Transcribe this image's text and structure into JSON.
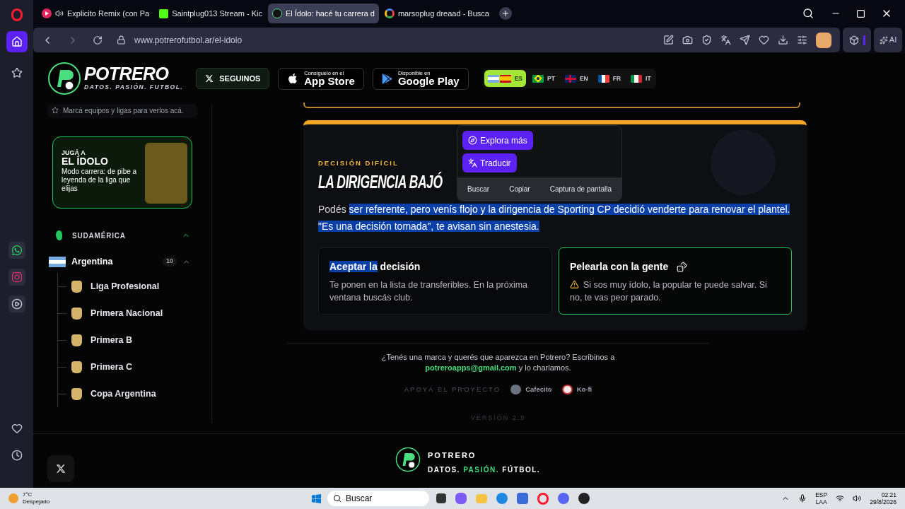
{
  "browser": {
    "tabs": [
      {
        "title": "Explicito Remix (con Pa",
        "kind": "video",
        "selected": false
      },
      {
        "title": "Saintplug013 Stream - Kic",
        "kind": "stream",
        "selected": false
      },
      {
        "title": "El Ídolo: hacé tu carrera d",
        "kind": "site",
        "selected": true
      },
      {
        "title": "marsoplug dreaad - Busca",
        "kind": "search",
        "selected": false
      }
    ],
    "url": "www.potrerofutbol.ar/el-idolo",
    "sidebar": [
      {
        "kind": "home",
        "selected": true
      },
      {
        "kind": "star",
        "selected": false
      },
      {
        "kind": "whatsapp",
        "selected": false
      },
      {
        "kind": "instagram",
        "selected": false
      },
      {
        "kind": "player",
        "selected": false
      },
      {
        "kind": "heart",
        "selected": false
      },
      {
        "kind": "clock",
        "selected": false
      }
    ],
    "ai_label": "AI"
  },
  "site_header": {
    "brand": "POTRERO",
    "tagline": "DATOS. PASIÓN. FUTBOL.",
    "follow": "SEGUINOS",
    "app_store": {
      "small": "Consiguelo en el",
      "big": "App Store"
    },
    "google_play": {
      "small": "Disponible en",
      "big": "Google Play"
    },
    "languages": [
      {
        "code": "ES",
        "selected": true
      },
      {
        "code": "PT",
        "selected": false
      },
      {
        "code": "EN",
        "selected": false
      },
      {
        "code": "FR",
        "selected": false
      },
      {
        "code": "IT",
        "selected": false
      }
    ]
  },
  "sidebar": {
    "hint": "Marcá equipos y ligas para verlos acá.",
    "promo": {
      "kicker": "JUGÁ A",
      "title": "EL ÍDOLO",
      "text": "Modo carrera: de pibe a leyenda de la liga que elijas"
    },
    "region": {
      "name": "SUDAMÉRICA",
      "expanded": true
    },
    "country": {
      "name": "Argentina",
      "count": "10",
      "expanded": true,
      "children": [
        {
          "name": "Liga Profesional"
        },
        {
          "name": "Primera Nacional"
        },
        {
          "name": "Primera B"
        },
        {
          "name": "Primera C"
        },
        {
          "name": "Copa Argentina"
        }
      ]
    }
  },
  "card": {
    "kicker": "DECISIÓN DIFÍCIL",
    "title": "LA DIRIGENCIA BAJÓ",
    "paragraph": [
      {
        "text": "Podés ",
        "selected": false
      },
      {
        "text": "ser referente, pero venís flojo y la dirigencia de Sporting CP decidió venderte para renovar el plantel. \"Es una decisión tomada\", te avisan sin anestesia.",
        "selected": true
      }
    ],
    "options": [
      {
        "title": [
          {
            "text": "Aceptar la",
            "selected": true
          },
          {
            "text": " decisión",
            "selected": false
          }
        ],
        "text": "Te ponen en la lista de transferibles. En la próxima ventana buscás club.",
        "selected": false,
        "warning": false,
        "dice": false
      },
      {
        "title": [
          {
            "text": "Pelearla con la gente",
            "selected": false
          }
        ],
        "text": "Si sos muy ídolo, la popular te puede salvar. Si no, te vas peor parado.",
        "selected": true,
        "warning": true,
        "dice": true
      }
    ]
  },
  "selection_popup": {
    "buttons": [
      "Explora más",
      "Traducir"
    ],
    "actions": [
      "Buscar",
      "Copiar",
      "Captura de pantalla"
    ]
  },
  "footer": {
    "contact": "¿Tenés una marca y querés que aparezca en Potrero? Escribinos a",
    "email": "potreroapps@gmail.com",
    "contact_end": "y lo charlamos.",
    "support_label": "APOYÁ EL PROYECTO",
    "support_links": [
      "Cafecito",
      "Ko-fi"
    ],
    "version": "VERSIÓN 2.5",
    "brand": "POTRERO",
    "tagline": [
      {
        "text": "DATOS.",
        "accent": false
      },
      {
        "text": "PASIÓN.",
        "accent": true
      },
      {
        "text": "FÚTBOL.",
        "accent": false
      }
    ]
  },
  "taskbar": {
    "weather_temp": "7°C",
    "weather_text": "Despejado",
    "search": "Buscar",
    "lang": "ESP",
    "layout": "LAA",
    "time": "02:21",
    "date": "29/8/2026"
  }
}
